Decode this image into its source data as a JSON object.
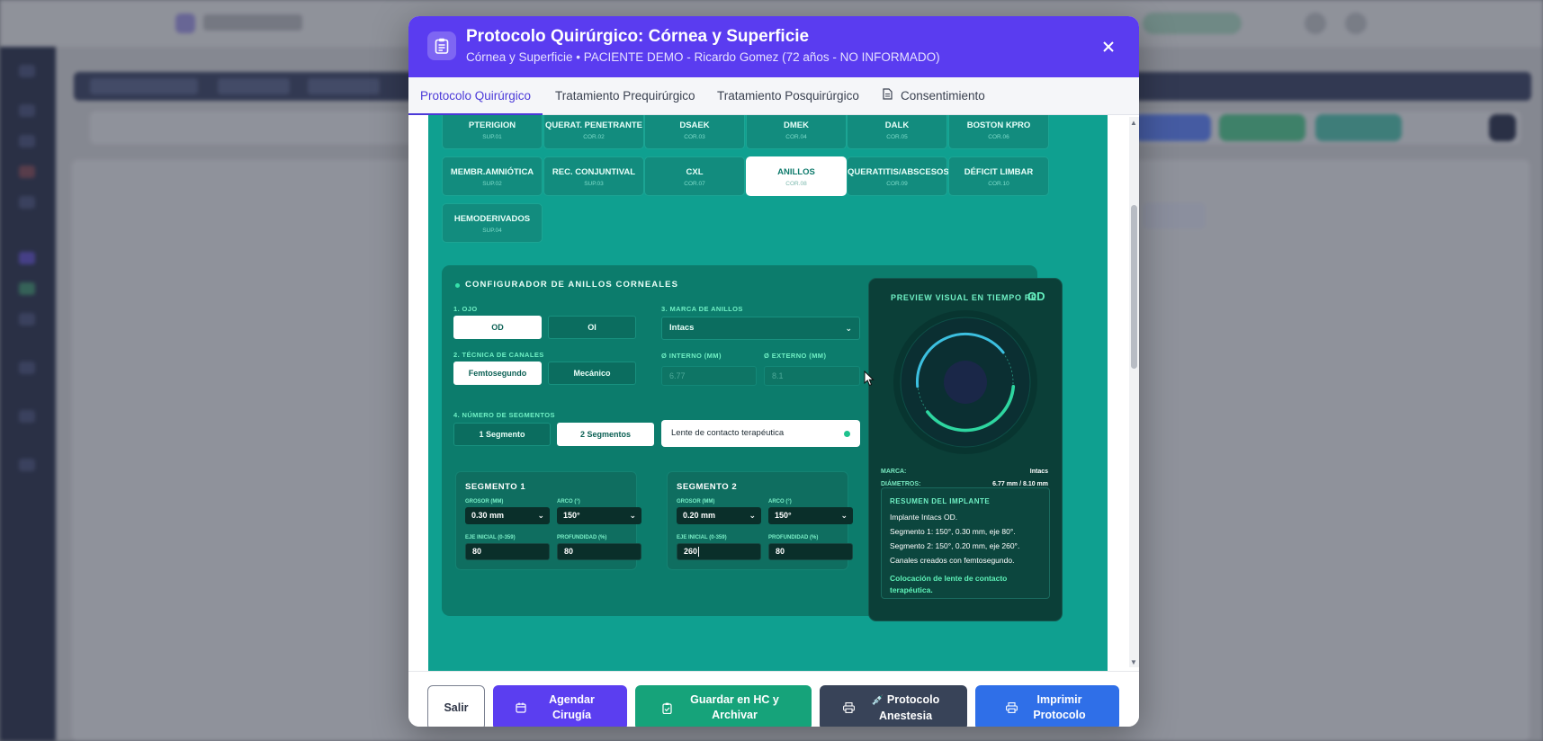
{
  "modal": {
    "title": "Protocolo Quirúrgico: Córnea y Superficie",
    "subtitle": "Córnea y Superficie • PACIENTE DEMO - Ricardo Gomez (72 años - NO INFORMADO)"
  },
  "tabs": [
    {
      "label": "Protocolo Quirúrgico",
      "active": true
    },
    {
      "label": "Tratamiento Prequirúrgico",
      "active": false
    },
    {
      "label": "Tratamiento Posquirúrgico",
      "active": false
    },
    {
      "label": "Consentimiento",
      "active": false
    }
  ],
  "procedures": [
    {
      "name": "PTERIGION",
      "code": "SUP.01"
    },
    {
      "name": "QUERAT. PENETRANTE",
      "code": "COR.02"
    },
    {
      "name": "DSAEK",
      "code": "COR.03"
    },
    {
      "name": "DMEK",
      "code": "COR.04"
    },
    {
      "name": "DALK",
      "code": "COR.05"
    },
    {
      "name": "BOSTON KPRO",
      "code": "COR.06"
    },
    {
      "name": "MEMBR.AMNIÓTICA",
      "code": "SUP.02"
    },
    {
      "name": "REC. CONJUNTIVAL",
      "code": "SUP.03"
    },
    {
      "name": "CXL",
      "code": "COR.07"
    },
    {
      "name": "ANILLOS",
      "code": "COR.08",
      "active": true
    },
    {
      "name": "QUERATITIS/ABSCESOS",
      "code": "COR.09"
    },
    {
      "name": "DÉFICIT LIMBAR",
      "code": "COR.10"
    },
    {
      "name": "HEMODERIVADOS",
      "code": "SUP.04"
    }
  ],
  "configurator": {
    "title": "CONFIGURADOR DE ANILLOS CORNEALES",
    "eye_label": "1. OJO",
    "eye_options": [
      "OD",
      "OI"
    ],
    "eye_selected": "OD",
    "brand_label": "3. MARCA DE ANILLOS",
    "brand_value": "Intacs",
    "technique_label": "2. TÉCNICA DE CANALES",
    "technique_options": [
      "Femtosegundo",
      "Mecánico"
    ],
    "technique_selected": "Femtosegundo",
    "inner_label": "Ø INTERNO (MM)",
    "inner_value": "6.77",
    "outer_label": "Ø EXTERNO (MM)",
    "outer_value": "8.1",
    "segments_label": "4. NÚMERO DE SEGMENTOS",
    "segment_options": [
      "1 Segmento",
      "2 Segmentos"
    ],
    "segment_selected": "2 Segmentos",
    "lens_label": "Lente de contacto terapéutica",
    "segments": [
      {
        "title": "SEGMENTO 1",
        "thickness_label": "GROSOR (MM)",
        "thickness": "0.30 mm",
        "arc_label": "ARCO (°)",
        "arc": "150°",
        "axis_label": "EJE INICIAL (0-359)",
        "axis": "80",
        "depth_label": "PROFUNDIDAD (%)",
        "depth": "80"
      },
      {
        "title": "SEGMENTO 2",
        "thickness_label": "GROSOR (MM)",
        "thickness": "0.20 mm",
        "arc_label": "ARCO (°)",
        "arc": "150°",
        "axis_label": "EJE INICIAL (0-359)",
        "axis": "260",
        "depth_label": "PROFUNDIDAD (%)",
        "depth": "80"
      }
    ]
  },
  "preview": {
    "title": "PREVIEW VISUAL EN TIEMPO RE",
    "eye": "OD",
    "brand_label": "MARCA:",
    "brand_value": "Intacs",
    "diam_label": "DIÁMETROS:",
    "diam_value": "6.77 mm / 8.10 mm",
    "summary_title": "RESUMEN DEL IMPLANTE",
    "summary_lines": [
      "Implante Intacs OD.",
      "Segmento 1: 150°, 0.30 mm, eje 80°.",
      "Segmento 2: 150°, 0.20 mm, eje 260°.",
      "Canales creados con femtosegundo."
    ],
    "summary_note": "Colocación de lente de contacto terapéutica."
  },
  "footer": {
    "exit": "Salir",
    "schedule": "Agendar Cirugía",
    "save": "Guardar en HC y Archivar",
    "anesthesia": "Protocolo Anestesia",
    "anesthesia_emoji": "💉",
    "print": "Imprimir Protocolo"
  },
  "colors": {
    "header": "#5a3cf0",
    "content": "#0fa090",
    "schedule": "#5b3ef0",
    "save": "#16a37a",
    "anesthesia": "#384358",
    "print": "#2f6fe8"
  }
}
